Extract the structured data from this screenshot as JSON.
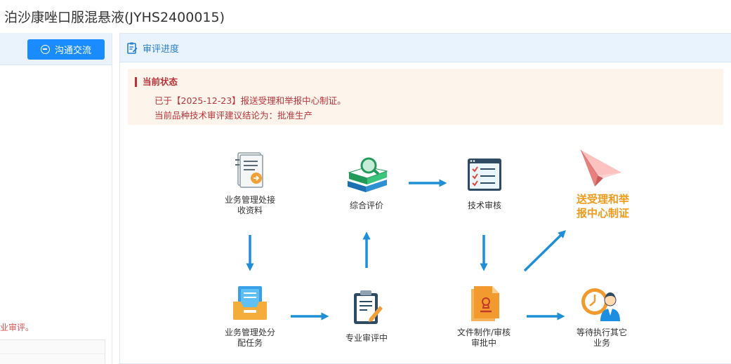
{
  "page": {
    "title": "泊沙康唑口服混悬液(JYHS2400015)"
  },
  "left_panel": {
    "chat_button_label": "沟通交流",
    "note_text": "业审评。"
  },
  "review": {
    "header_label": "审评进度",
    "status_title": "当前状态",
    "status_line_1": "已于【2025-12-23】报送受理和举报中心制证。",
    "status_line_2": "当前品种技术审评建议结论为：批准生产"
  },
  "flow": {
    "steps": [
      {
        "id": "receive",
        "label_1": "业务管理处接",
        "label_2": "收资料",
        "icon": "document-inbox-icon"
      },
      {
        "id": "assign",
        "label_1": "业务管理处分",
        "label_2": "配任务",
        "icon": "tray-documents-icon"
      },
      {
        "id": "pro_review",
        "label_1": "专业审评中",
        "label_2": "",
        "icon": "clipboard-pen-icon"
      },
      {
        "id": "comprehensive",
        "label_1": "综合评价",
        "label_2": "",
        "icon": "books-magnifier-icon"
      },
      {
        "id": "tech_review",
        "label_1": "技术审核",
        "label_2": "",
        "icon": "checklist-icon"
      },
      {
        "id": "doc_making",
        "label_1": "文件制作/审核",
        "label_2": "审批中",
        "icon": "stamped-document-icon"
      },
      {
        "id": "certify",
        "label_1": "送受理和举",
        "label_2": "报中心制证",
        "icon": "paper-plane-icon",
        "current": true
      },
      {
        "id": "other",
        "label_1": "等待执行其它",
        "label_2": "业务",
        "icon": "clock-person-icon"
      }
    ]
  },
  "colors": {
    "primary": "#1a8cff",
    "arrow": "#1e8fd6",
    "status_text": "#b8343a",
    "status_bg": "#fdf4ec",
    "current_step": "#f09a1a"
  }
}
